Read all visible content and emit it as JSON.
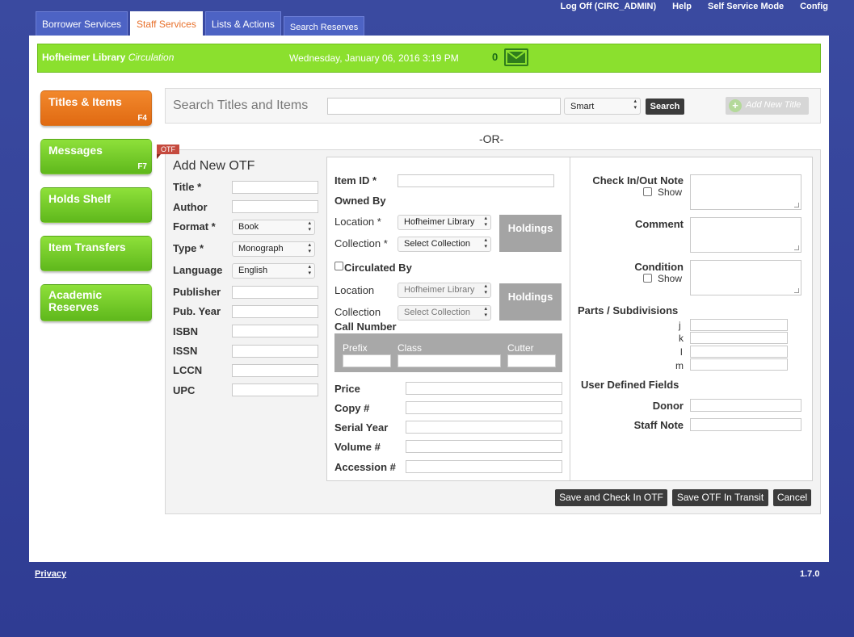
{
  "top_links": [
    "Log Off (CIRC_ADMIN)",
    "Help",
    "Self Service Mode",
    "Config"
  ],
  "tabs": [
    "Borrower Services",
    "Staff Services",
    "Lists & Actions",
    "Search Reserves"
  ],
  "header": {
    "library": "Hofheimer Library",
    "module": "Circulation",
    "datetime": "Wednesday, January 06, 2016 3:19 PM",
    "message_count": "0"
  },
  "nav": [
    {
      "label": "Titles & Items",
      "key": "F4"
    },
    {
      "label": "Messages",
      "key": "F7"
    },
    {
      "label": "Holds Shelf",
      "key": ""
    },
    {
      "label": "Item Transfers",
      "key": ""
    },
    {
      "label": "Academic Reserves",
      "key": ""
    }
  ],
  "search": {
    "label": "Search Titles and Items",
    "value": "",
    "mode": "Smart",
    "button": "Search",
    "add_title": "Add New Title"
  },
  "or_text": "-OR-",
  "otf_badge": "OTF",
  "form_title": "Add New OTF",
  "left_fields": {
    "title": "Title *",
    "author": "Author",
    "format": "Format *",
    "format_value": "Book",
    "type": "Type *",
    "type_value": "Monograph",
    "language": "Language",
    "language_value": "English",
    "publisher": "Publisher",
    "pub_year": "Pub. Year",
    "isbn": "ISBN",
    "issn": "ISSN",
    "lccn": "LCCN",
    "upc": "UPC"
  },
  "middle": {
    "item_id": "Item ID *",
    "owned_by": "Owned By",
    "location": "Location *",
    "location_value": "Hofheimer Library",
    "collection": "Collection *",
    "collection_value": "Select Collection",
    "holdings": "Holdings",
    "circulated_by": "Circulated By",
    "circ_location": "Location",
    "circ_location_value": "Hofheimer Library",
    "circ_collection": "Collection",
    "circ_collection_value": "Select Collection",
    "call_number": "Call Number",
    "prefix": "Prefix",
    "class": "Class",
    "cutter": "Cutter",
    "price": "Price",
    "copy": "Copy #",
    "serial_year": "Serial Year",
    "volume": "Volume #",
    "accession": "Accession #"
  },
  "right": {
    "checkin_note": "Check In/Out Note",
    "show": "Show",
    "comment": "Comment",
    "condition": "Condition",
    "parts": "Parts / Subdivisions",
    "parts_labels": [
      "j",
      "k",
      "l",
      "m"
    ],
    "user_defined": "User Defined Fields",
    "donor": "Donor",
    "staff_note": "Staff Note"
  },
  "actions": {
    "save_checkin": "Save and Check In OTF",
    "save_transit": "Save OTF In Transit",
    "cancel": "Cancel"
  },
  "footer": {
    "privacy": "Privacy",
    "version": "1.7.0"
  },
  "colors": {
    "green_header": "#8be02e",
    "orange_nav": "#e8702a",
    "background": "#34449a"
  }
}
